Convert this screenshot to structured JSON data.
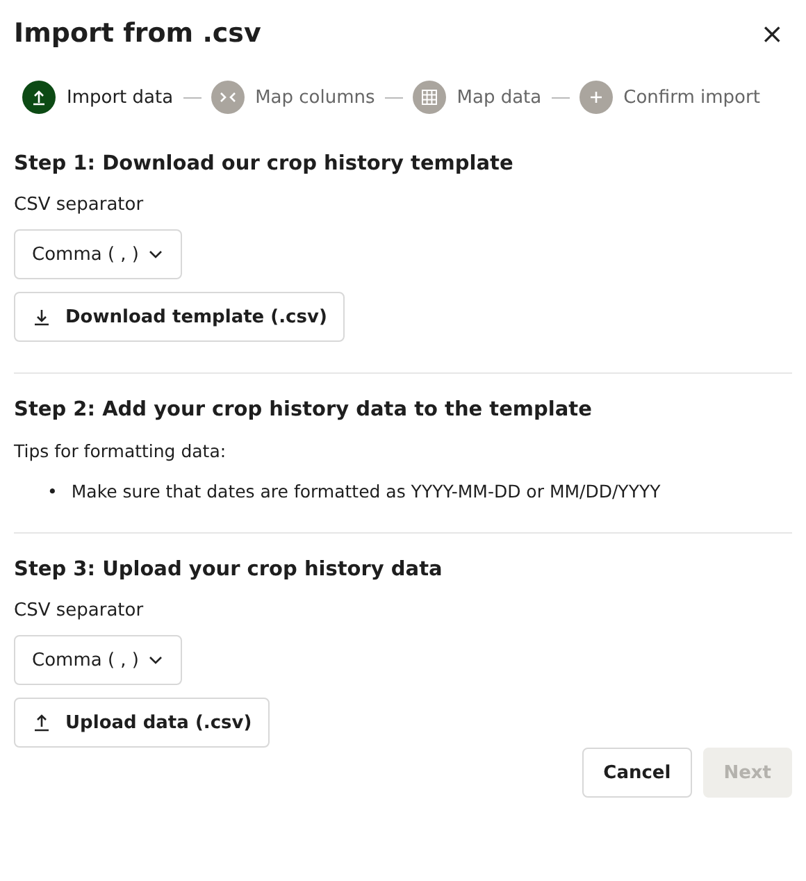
{
  "dialog": {
    "title": "Import from .csv",
    "close_icon": "×"
  },
  "steps": [
    {
      "label": "Import data",
      "kind": "upload",
      "selected": true
    },
    {
      "label": "Map columns",
      "kind": "columns",
      "selected": false
    },
    {
      "label": "Map data",
      "kind": "grid",
      "selected": false
    },
    {
      "label": "Confirm import",
      "kind": "plus",
      "selected": false
    }
  ],
  "sections": [
    {
      "heading": "Step 1: Download our crop history template",
      "kind": "download",
      "separator_label": "CSV separator",
      "separator_value": "Comma ( , )",
      "button": "Download template (.csv)"
    },
    {
      "heading": "Step 2: Add your crop history data to the template",
      "kind": "tips",
      "tips_label": "Tips for formatting data:",
      "tips": [
        {
          "marker": "•",
          "text": "Make sure that dates are formatted as YYYY-MM-DD or MM/DD/YYYY"
        }
      ]
    },
    {
      "heading": "Step 3: Upload your crop history data",
      "kind": "upload",
      "separator_label": "CSV separator",
      "separator_value": "Comma ( , )",
      "button": "Upload data (.csv)"
    }
  ],
  "footer": [
    {
      "label": "Cancel",
      "disabled": false
    },
    {
      "label": "Next",
      "disabled": true
    }
  ]
}
